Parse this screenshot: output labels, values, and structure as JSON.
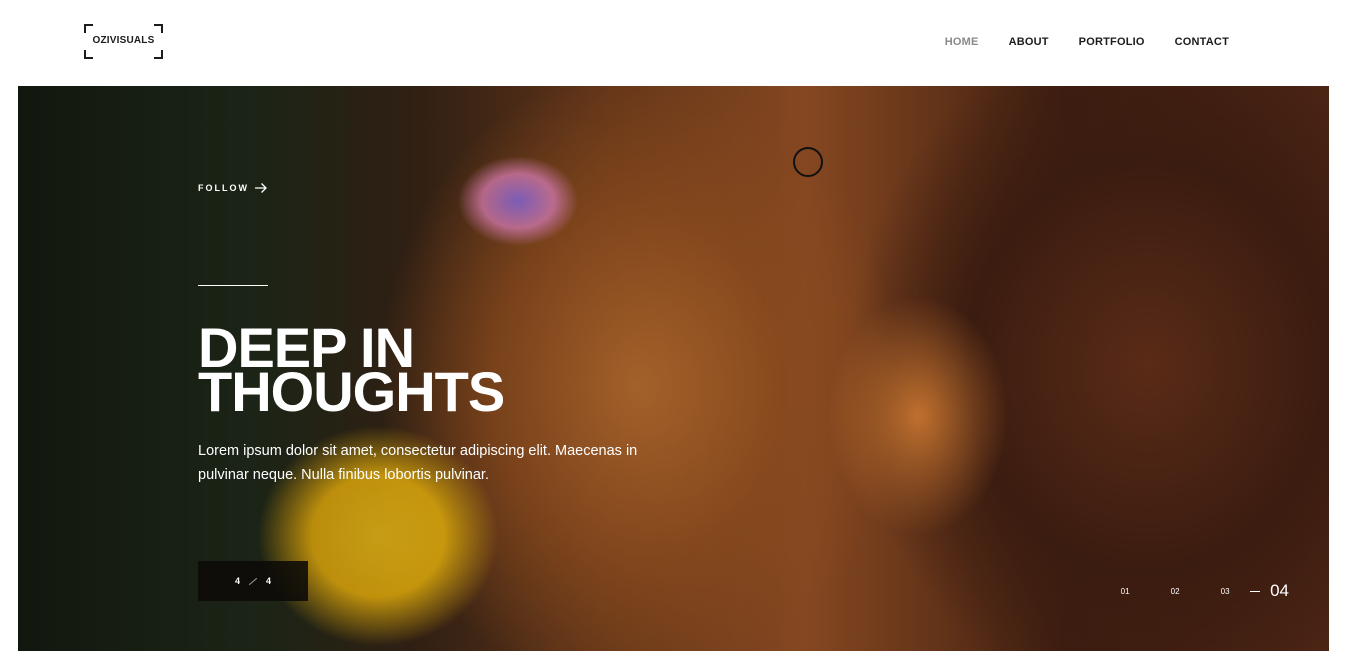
{
  "header": {
    "logo_text": "OZIVISUALS",
    "nav": [
      {
        "label": "HOME",
        "active": true
      },
      {
        "label": "ABOUT",
        "active": false
      },
      {
        "label": "PORTFOLIO",
        "active": false
      },
      {
        "label": "CONTACT",
        "active": false
      }
    ]
  },
  "hero": {
    "follow_label": "FOLLOW",
    "follow_icon": "arrow-right-icon",
    "title_line1": "DEEP IN",
    "title_line2": "THOUGHTS",
    "description": "Lorem ipsum dolor sit amet, consectetur adipiscing elit. Maecenas in pulvinar neque. Nulla finibus lobortis pulvinar.",
    "counter_current": "4",
    "counter_total": "4",
    "pager": [
      "01",
      "02",
      "03"
    ],
    "pager_active": "04"
  },
  "colors": {
    "text_dark": "#1c1c1c",
    "nav_active": "#8a8a8a",
    "hero_text": "#ffffff",
    "counter_bg": "#0c0a08"
  }
}
